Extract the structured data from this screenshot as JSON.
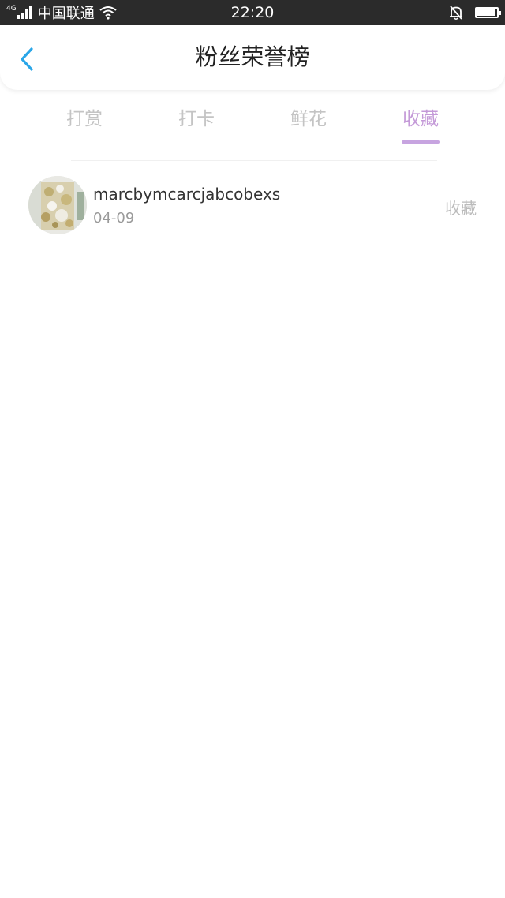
{
  "status_bar": {
    "network": "4G",
    "carrier": "中国联通",
    "time": "22:20",
    "battery_level": 0.9,
    "icons": [
      "signal-icon",
      "wifi-icon",
      "bell-muted-icon",
      "battery-icon"
    ]
  },
  "header": {
    "title": "粉丝荣誉榜",
    "back_icon": "chevron-left-icon",
    "accent_color": "#2aa6e8"
  },
  "tabs": [
    {
      "label": "打赏",
      "active": false
    },
    {
      "label": "打卡",
      "active": false
    },
    {
      "label": "鲜花",
      "active": false
    },
    {
      "label": "收藏",
      "active": true
    }
  ],
  "colors": {
    "tab_active": "#c49ad8",
    "tab_inactive": "#c4c4c4",
    "indicator": "#c7a4e0"
  },
  "list": [
    {
      "username": "marcbymcarcjabcobexs",
      "date": "04-09",
      "action": "收藏",
      "avatar_icon": "user-avatar-image"
    }
  ]
}
